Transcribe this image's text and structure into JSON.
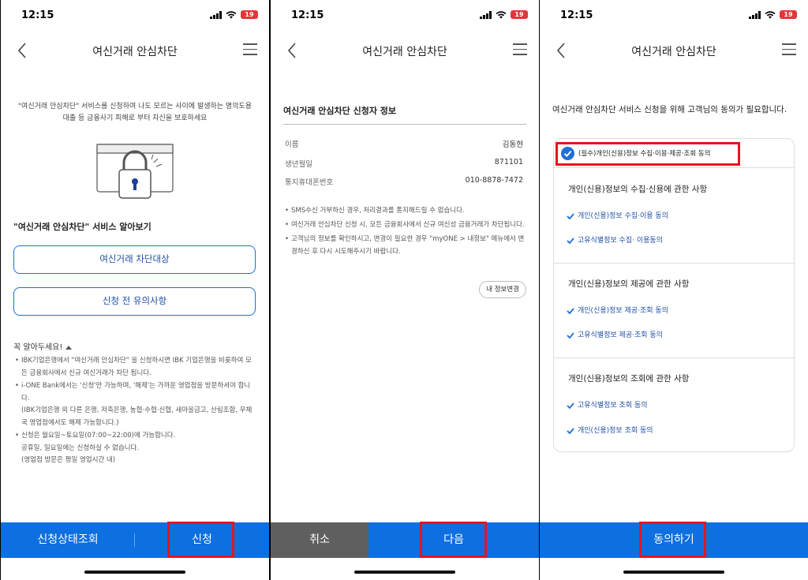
{
  "status": {
    "time": "12:15",
    "battery": "19"
  },
  "panel1": {
    "title": "여신거래 안심차단",
    "intro": "\"여신거래 안심차단\" 서비스를 신청하여 나도 모르는 사이에 발생하는 명의도용 대출 등 금융사기 피해로 부터 자신을 보호하세요",
    "section_title": "\"여신거래 안심차단\" 서비스 알아보기",
    "btn_targets": "여신거래 차단대상",
    "btn_notice": "신청 전 유의사항",
    "notice_title": "꼭 알아두세요!",
    "notes": [
      {
        "text": "IBK기업은행에서 \"여신거래 안심차단\" 을 신청하시면 IBK 기업은행을 비롯하여 모든 금융회사에서 신규 여신거래가 차단 됩니다."
      },
      {
        "text": "i-ONE Bank에서는 '신청'만 가능하며, '해제'는 가까운 영업점을 방문하셔야 합니다.",
        "sub": "(IBK기업은행 외 다른 은행, 저축은행, 농협·수협·신협, 새마을금고, 산림조합, 우체국 영업점에서도 해제 가능합니다.)"
      },
      {
        "text": "신청은 월요일~토요일(07:00~22:00)에 가능합니다.",
        "sub": "공휴일, 일요일에는 신청하실 수 없습니다.",
        "sub2": "(영업점 방문은 평일 영업시간 내)"
      }
    ],
    "bottom_left": "신청상태조회",
    "bottom_right": "신청"
  },
  "panel2": {
    "title": "여신거래 안심차단",
    "heading": "여신거래 안심차단 신청자 정보",
    "rows": [
      {
        "label": "이름",
        "value": "김동현"
      },
      {
        "label": "생년월일",
        "value": "871101"
      },
      {
        "label": "통지휴대폰번호",
        "value": "010-8878-7472"
      }
    ],
    "notes": [
      "SMS수신 거부하신 경우, 처리결과를 통지해드릴 수 없습니다.",
      "여신거래 안심차단 신청 시, 모든 금융회사에서 신규 여신성 금융거래가 차단됩니다.",
      "고객님의 정보를 확인하시고, 변경이 필요한 경우 \"myONE > 내정보\" 메뉴에서 변경하신 후 다시 시도해주시기 바랍니다."
    ],
    "btn_edit": "내 정보변경",
    "cancel": "취소",
    "next": "다음"
  },
  "panel3": {
    "title": "여신거래 안심차단",
    "intro": "여신거래 안심차단 서비스 신청을 위해 고객님의 동의가 필요합니다.",
    "required_label": "(필수)개인(신용)정보 수집·이용·제공·조회 동의",
    "groups": [
      {
        "title": "개인(신용)정보의 수집·신용에 관한 사항",
        "items": [
          "개인(신용)정보 수집·이용 동의",
          "고유식별정보 수집· 이용동의"
        ]
      },
      {
        "title": "개인(신용)정보의 제공에 관한 사항",
        "items": [
          "개인(신용)정보 제공·조회 동의",
          "고유식별정보 제공·조회 동의"
        ]
      },
      {
        "title": "개인(신용)정보의 조회에 관한 사항",
        "items": [
          "고유식별정보 조회 동의",
          "개인(신용)정보 조회 동의"
        ]
      }
    ],
    "agree": "동의하기"
  },
  "colors": {
    "primary": "#0d6fe0",
    "highlight": "#e1161f",
    "cancel_gray": "#5f5f5f"
  }
}
